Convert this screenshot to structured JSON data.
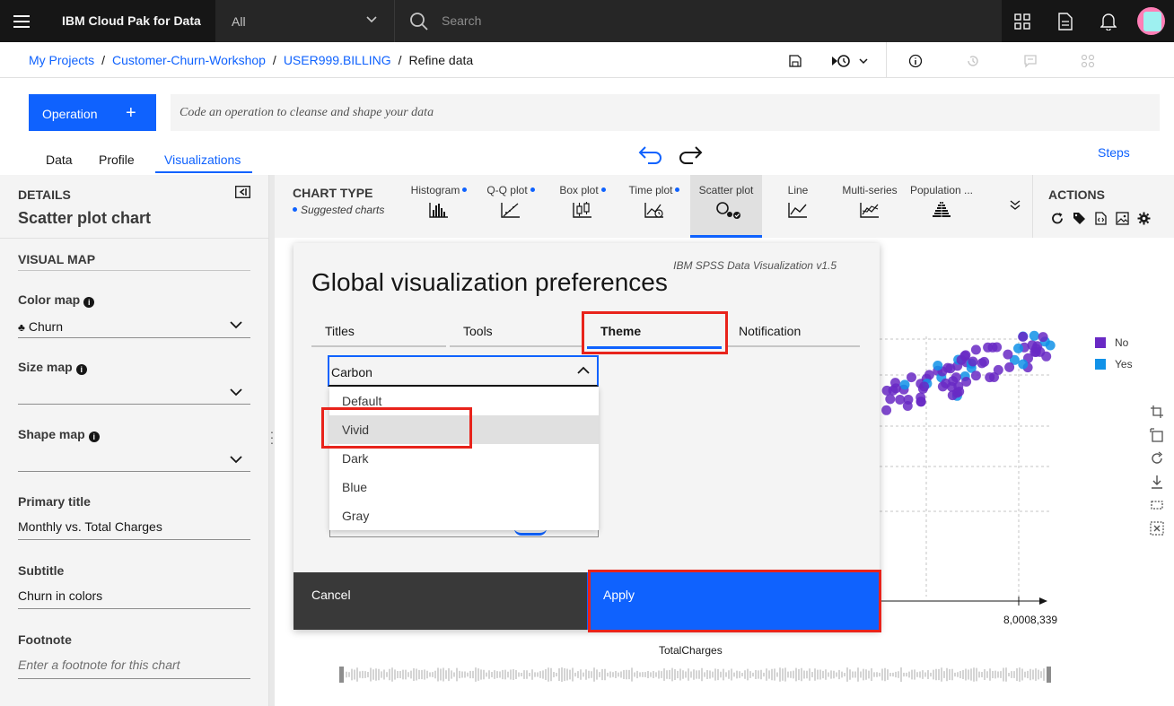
{
  "header": {
    "brand": "IBM Cloud Pak for Data",
    "scope": "All",
    "search_placeholder": "Search"
  },
  "breadcrumb": {
    "items": [
      "My Projects",
      "Customer-Churn-Workshop",
      "USER999.BILLING"
    ],
    "current": "Refine data"
  },
  "operation": {
    "button_label": "Operation",
    "button_icon": "+",
    "code_placeholder": "Code an operation to cleanse and shape your data"
  },
  "tabs": [
    "Data",
    "Profile",
    "Visualizations"
  ],
  "selected_tab": "Visualizations",
  "steps_label": "Steps",
  "details": {
    "heading": "DETAILS",
    "chart_name": "Scatter plot chart",
    "visual_map": "VISUAL MAP",
    "color_map_label": "Color map",
    "color_map_value": "Churn",
    "size_map_label": "Size map",
    "shape_map_label": "Shape map",
    "primary_title_label": "Primary title",
    "primary_title_value": "Monthly vs. Total Charges",
    "subtitle_label": "Subtitle",
    "subtitle_value": "Churn in colors",
    "footnote_label": "Footnote",
    "footnote_placeholder": "Enter a footnote for this chart"
  },
  "chart_type": {
    "heading": "CHART TYPE",
    "suggested": "Suggested charts",
    "items": [
      "Histogram",
      "Q-Q plot",
      "Box plot",
      "Time plot",
      "Scatter plot",
      "Line",
      "Multi-series",
      "Population ..."
    ],
    "selected": "Scatter plot"
  },
  "actions": {
    "heading": "ACTIONS"
  },
  "chart": {
    "legend": [
      {
        "label": "No",
        "color": "#6929c4"
      },
      {
        "label": "Yes",
        "color": "#1192e8"
      }
    ],
    "x_tick": "8,0008,339",
    "x_label": "TotalCharges"
  },
  "modal": {
    "version": "IBM SPSS Data Visualization v1.5",
    "title": "Global visualization preferences",
    "tabs": [
      "Titles",
      "Tools",
      "Theme",
      "Notification"
    ],
    "selected_tab": "Theme",
    "theme_value": "Carbon",
    "theme_options": [
      "Default",
      "Vivid",
      "Dark",
      "Blue",
      "Gray"
    ],
    "highlighted_option": "Vivid",
    "cancel_label": "Cancel",
    "apply_label": "Apply"
  },
  "colors": {
    "accent": "#0f62fe",
    "highlight_box": "#e8231b",
    "header_bg": "#161616"
  }
}
